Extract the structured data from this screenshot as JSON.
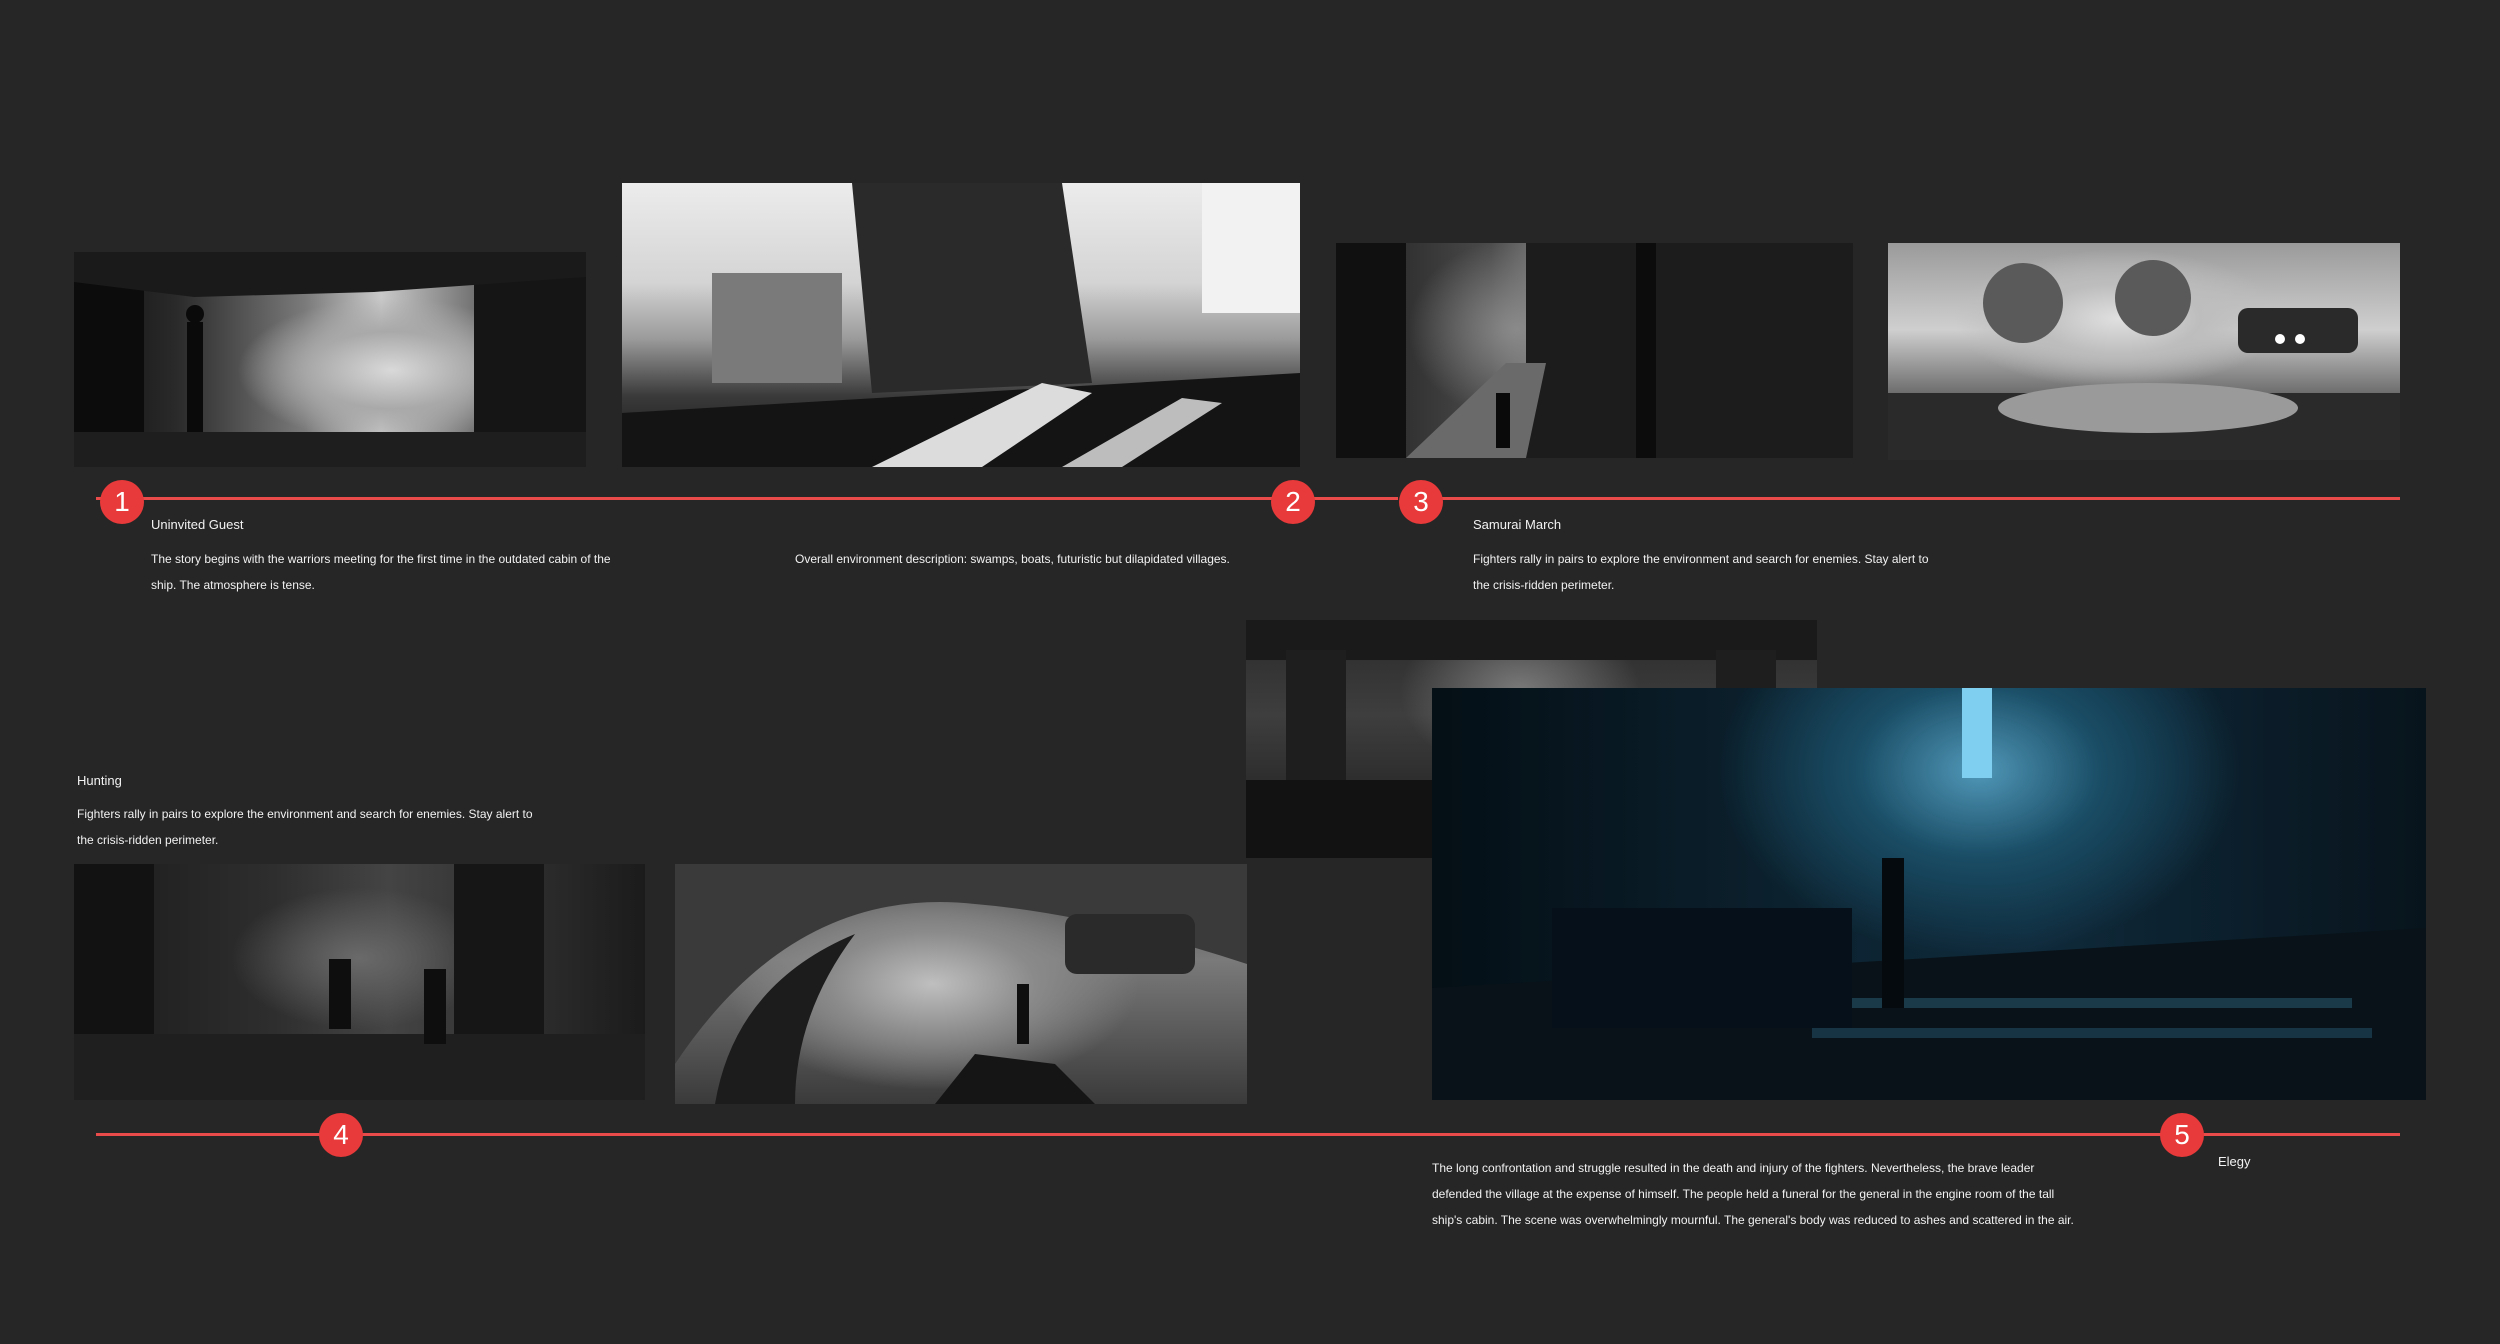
{
  "markers": [
    "1",
    "2",
    "3",
    "4",
    "5"
  ],
  "scenes": {
    "uninvited_guest": {
      "title": "Uninvited Guest",
      "desc_line1": "The story begins with the warriors meeting for the first time in the outdated cabin of the",
      "desc_line2": "ship. The atmosphere is tense."
    },
    "environment": {
      "desc": "Overall environment description: swamps, boats, futuristic but dilapidated villages."
    },
    "samurai_march": {
      "title": "Samurai March",
      "desc_line1": "Fighters rally in pairs to explore the environment and search for enemies. Stay alert to",
      "desc_line2": "the crisis-ridden perimeter."
    },
    "hunting": {
      "title": "Hunting",
      "desc_line1": "Fighters rally in pairs to explore the environment and search for enemies. Stay alert to",
      "desc_line2": "the crisis-ridden perimeter."
    },
    "elegy": {
      "title": "Elegy",
      "desc_line1": "The long confrontation and struggle resulted in the death and injury of the fighters. Nevertheless, the brave leader",
      "desc_line2": "defended the village at the expense of himself. The people held a funeral for the general in the engine room of the tall",
      "desc_line3": "ship's cabin. The scene was overwhelmingly mournful. The general's body was reduced to ashes and scattered in the air."
    }
  },
  "colors": {
    "background": "#262626",
    "timeline": "#e94a4a",
    "marker": "#e83a3a",
    "text": "#f2f2f2"
  }
}
